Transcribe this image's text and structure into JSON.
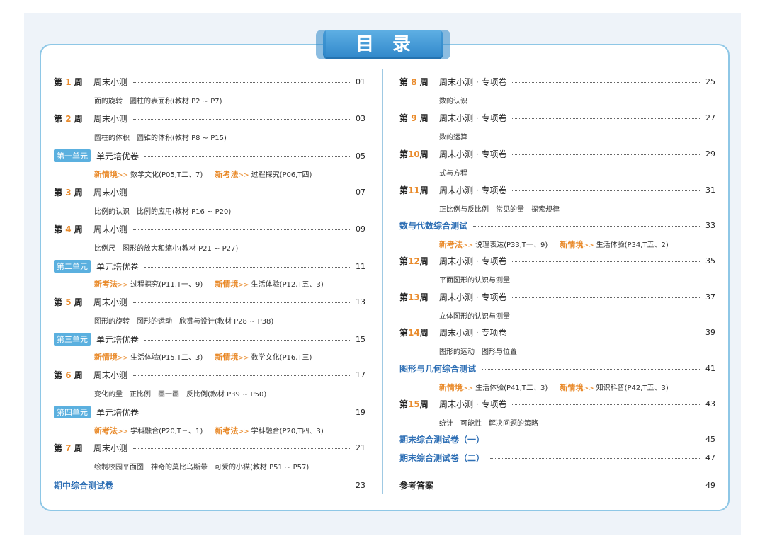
{
  "header": {
    "title": "目录"
  },
  "left": [
    {
      "type": "week",
      "week_pre": "第",
      "week_num": "1",
      "week_post": "周",
      "name": "周末小测",
      "page": "01",
      "sub": "面的旋转　圆柱的表面积(教材 P2 ~ P7)"
    },
    {
      "type": "week",
      "week_pre": "第",
      "week_num": "2",
      "week_post": "周",
      "name": "周末小测",
      "page": "03",
      "sub": "圆柱的体积　圆锥的体积(教材 P8 ~ P15)"
    },
    {
      "type": "unit",
      "unit": "第一单元",
      "name": "单元培优卷",
      "page": "05",
      "tags": [
        {
          "label": "新情境",
          "arrow": ">>",
          "text": "数学文化(P05,T二、7)"
        },
        {
          "label": "新考法",
          "arrow": ">>",
          "text": "过程探究(P06,T四)"
        }
      ]
    },
    {
      "type": "week",
      "week_pre": "第",
      "week_num": "3",
      "week_post": "周",
      "name": "周末小测",
      "page": "07",
      "sub": "比例的认识　比例的应用(教材 P16 ~ P20)"
    },
    {
      "type": "week",
      "week_pre": "第",
      "week_num": "4",
      "week_post": "周",
      "name": "周末小测",
      "page": "09",
      "sub": "比例尺　图形的放大和缩小(教材 P21 ~ P27)"
    },
    {
      "type": "unit",
      "unit": "第二单元",
      "name": "单元培优卷",
      "page": "11",
      "tags": [
        {
          "label": "新考法",
          "arrow": ">>",
          "text": "过程探究(P11,T一、9)"
        },
        {
          "label": "新情境",
          "arrow": ">>",
          "text": "生活体验(P12,T五、3)"
        }
      ]
    },
    {
      "type": "week",
      "week_pre": "第",
      "week_num": "5",
      "week_post": "周",
      "name": "周末小测",
      "page": "13",
      "sub": "图形的旋转　图形的运动　欣赏与设计(教材 P28 ~ P38)"
    },
    {
      "type": "unit",
      "unit": "第三单元",
      "name": "单元培优卷",
      "page": "15",
      "tags": [
        {
          "label": "新情境",
          "arrow": ">>",
          "text": "生活体验(P15,T二、3)"
        },
        {
          "label": "新情境",
          "arrow": ">>",
          "text": "数学文化(P16,T三)"
        }
      ]
    },
    {
      "type": "week",
      "week_pre": "第",
      "week_num": "6",
      "week_post": "周",
      "name": "周末小测",
      "page": "17",
      "sub": "变化的量　正比例　画一画　反比例(教材 P39 ~ P50)"
    },
    {
      "type": "unit",
      "unit": "第四单元",
      "name": "单元培优卷",
      "page": "19",
      "tags": [
        {
          "label": "新考法",
          "arrow": ">>",
          "text": "学科融合(P20,T三、1)"
        },
        {
          "label": "新考法",
          "arrow": ">>",
          "text": "学科融合(P20,T四、3)"
        }
      ]
    },
    {
      "type": "week",
      "week_pre": "第",
      "week_num": "7",
      "week_post": "周",
      "name": "周末小测",
      "page": "21",
      "sub": "绘制校园平面图　神奇的莫比乌斯带　可爱的小猫(教材 P51 ~ P57)"
    },
    {
      "type": "test",
      "name": "期中综合测试卷",
      "page": "23"
    }
  ],
  "right": [
    {
      "type": "week",
      "week_pre": "第",
      "week_num": "8",
      "week_post": "周",
      "name": "周末小测 · 专项卷",
      "page": "25",
      "sub": "数的认识"
    },
    {
      "type": "week",
      "week_pre": "第",
      "week_num": "9",
      "week_post": "周",
      "name": "周末小测 · 专项卷",
      "page": "27",
      "sub": "数的运算"
    },
    {
      "type": "week",
      "week_pre": "第",
      "week_num": "10",
      "week_post": "周",
      "name": "周末小测 · 专项卷",
      "page": "29",
      "sub": "式与方程"
    },
    {
      "type": "week",
      "week_pre": "第",
      "week_num": "11",
      "week_post": "周",
      "name": "周末小测 · 专项卷",
      "page": "31",
      "sub": "正比例与反比例　常见的量　探索规律"
    },
    {
      "type": "test",
      "name": "数与代数综合测试",
      "page": "33",
      "tags": [
        {
          "label": "新考法",
          "arrow": ">>",
          "text": "说理表达(P33,T一、9)"
        },
        {
          "label": "新情境",
          "arrow": ">>",
          "text": "生活体验(P34,T五、2)"
        }
      ]
    },
    {
      "type": "week",
      "week_pre": "第",
      "week_num": "12",
      "week_post": "周",
      "name": "周末小测 · 专项卷",
      "page": "35",
      "sub": "平面图形的认识与测量"
    },
    {
      "type": "week",
      "week_pre": "第",
      "week_num": "13",
      "week_post": "周",
      "name": "周末小测 · 专项卷",
      "page": "37",
      "sub": "立体图形的认识与测量"
    },
    {
      "type": "week",
      "week_pre": "第",
      "week_num": "14",
      "week_post": "周",
      "name": "周末小测 · 专项卷",
      "page": "39",
      "sub": "图形的运动　图形与位置"
    },
    {
      "type": "test",
      "name": "图形与几何综合测试",
      "page": "41",
      "tags": [
        {
          "label": "新情境",
          "arrow": ">>",
          "text": "生活体验(P41,T二、3)"
        },
        {
          "label": "新情境",
          "arrow": ">>",
          "text": "知识科普(P42,T五、3)"
        }
      ]
    },
    {
      "type": "week",
      "week_pre": "第",
      "week_num": "15",
      "week_post": "周",
      "name": "周末小测 · 专项卷",
      "page": "43",
      "sub": "统计　可能性　解决问题的策略"
    },
    {
      "type": "test",
      "name": "期末综合测试卷（一）",
      "page": "45"
    },
    {
      "type": "test",
      "name": "期末综合测试卷（二）",
      "page": "47"
    },
    {
      "type": "answer",
      "name": "参考答案",
      "page": "49"
    }
  ]
}
